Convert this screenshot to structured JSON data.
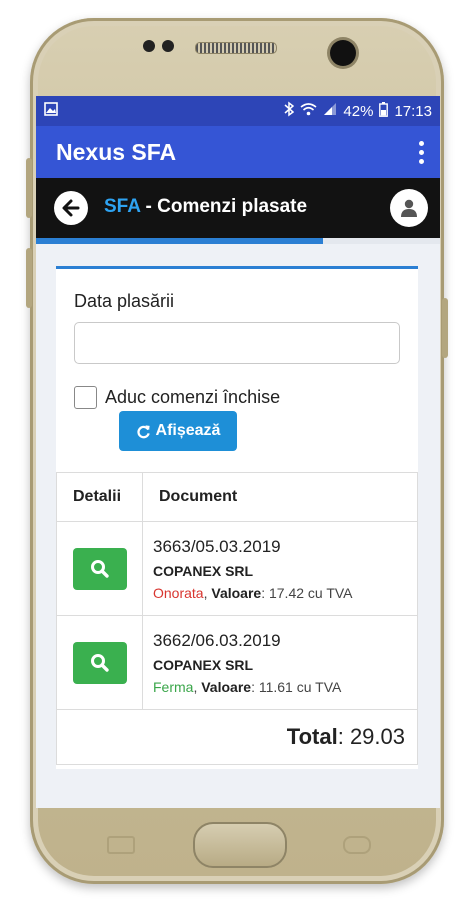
{
  "statusbar": {
    "battery": "42%",
    "time": "17:13"
  },
  "appbar": {
    "title": "Nexus SFA"
  },
  "pagebar": {
    "prefix": "SFA",
    "suffix": " - Comenzi plasate"
  },
  "filters": {
    "date_label": "Data plasării",
    "date_value": "",
    "closed_label": "Aduc comenzi închise",
    "closed_checked": false,
    "show_button": "Afișează"
  },
  "table": {
    "headers": {
      "details": "Detalii",
      "document": "Document"
    },
    "rows": [
      {
        "doc": "3663/05.03.2019",
        "company": "COPANEX SRL",
        "status": "Onorata",
        "value_label": "Valoare",
        "value": ": 17.42 cu TVA"
      },
      {
        "doc": "3662/06.03.2019",
        "company": "COPANEX SRL",
        "status": "Ferma",
        "value_label": "Valoare",
        "value": ": 11.61 cu TVA"
      }
    ],
    "total_label": "Total",
    "total_value": ": 29.03"
  },
  "colors": {
    "statusbar": "#2d45b7",
    "appbar": "#3555d5",
    "accent": "#2b7fd3",
    "onorata": "#d8352f",
    "ferma": "#3aa64a",
    "search_button": "#3ab04f"
  },
  "icons": [
    "image-icon",
    "bluetooth-icon",
    "wifi-icon",
    "signal-icon",
    "battery-icon",
    "more-vert-icon",
    "arrow-left-icon",
    "user-icon",
    "refresh-icon",
    "search-icon"
  ]
}
